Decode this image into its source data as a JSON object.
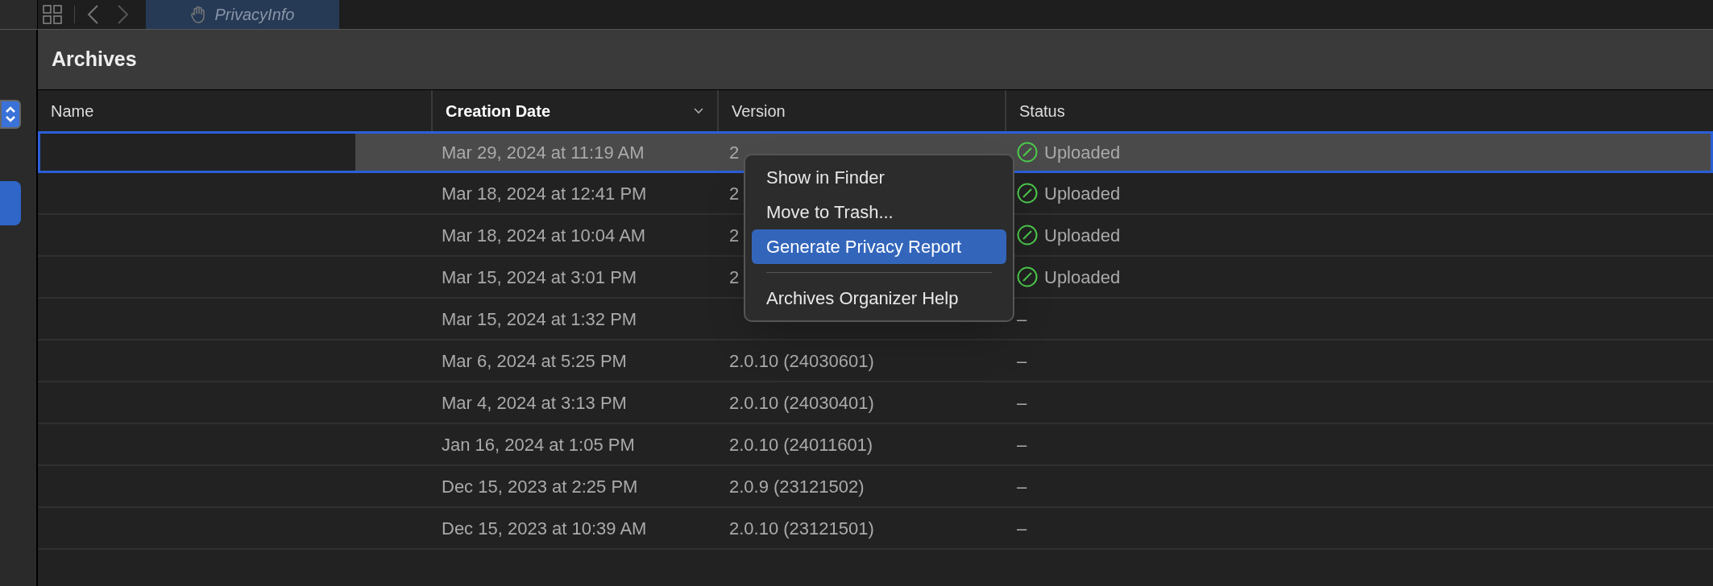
{
  "toolbar": {
    "tab": {
      "title": "PrivacyInfo",
      "selected": true
    }
  },
  "panel": {
    "title": "Archives"
  },
  "table": {
    "columns": [
      {
        "label": "Name",
        "sorted": false
      },
      {
        "label": "Creation Date",
        "sorted": true
      },
      {
        "label": "Version",
        "sorted": false
      },
      {
        "label": "Status",
        "sorted": false
      }
    ],
    "rows": [
      {
        "date": "Mar 29, 2024 at 11:19 AM",
        "version": "2",
        "status": "Uploaded",
        "uploaded": true,
        "selected": true
      },
      {
        "date": "Mar 18, 2024 at 12:41 PM",
        "version": "2",
        "status": "Uploaded",
        "uploaded": true,
        "selected": false
      },
      {
        "date": "Mar 18, 2024 at 10:04 AM",
        "version": "2",
        "status": "Uploaded",
        "uploaded": true,
        "selected": false
      },
      {
        "date": "Mar 15, 2024 at 3:01 PM",
        "version": "2",
        "status": "Uploaded",
        "uploaded": true,
        "selected": false
      },
      {
        "date": "Mar 15, 2024 at 1:32 PM",
        "status": "–",
        "uploaded": false,
        "selected": false
      },
      {
        "date": "Mar 6, 2024 at 5:25 PM",
        "version": "2.0.10 (24030601)",
        "status": "–",
        "uploaded": false,
        "selected": false
      },
      {
        "date": "Mar 4, 2024 at 3:13 PM",
        "version": "2.0.10 (24030401)",
        "status": "–",
        "uploaded": false,
        "selected": false
      },
      {
        "date": "Jan 16, 2024 at 1:05 PM",
        "version": "2.0.10 (24011601)",
        "status": "–",
        "uploaded": false,
        "selected": false
      },
      {
        "date": "Dec 15, 2023 at 2:25 PM",
        "version": "2.0.9 (23121502)",
        "status": "–",
        "uploaded": false,
        "selected": false
      },
      {
        "date": "Dec 15, 2023 at 10:39 AM",
        "version": "2.0.10 (23121501)",
        "status": "–",
        "uploaded": false,
        "selected": false
      }
    ]
  },
  "context_menu": {
    "items": [
      {
        "kind": "item",
        "label": "Show in Finder",
        "selected": false
      },
      {
        "kind": "item",
        "label": "Move to Trash...",
        "selected": false
      },
      {
        "kind": "item",
        "label": "Generate Privacy Report",
        "selected": true
      },
      {
        "kind": "separator"
      },
      {
        "kind": "item",
        "label": "Archives Organizer Help",
        "selected": false
      }
    ]
  }
}
